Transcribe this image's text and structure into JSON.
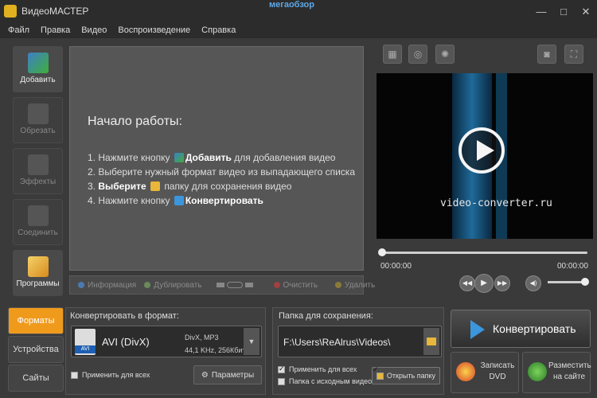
{
  "window": {
    "title": "ВидеоМАСТЕР",
    "watermark": "мегаобзор",
    "controls": [
      "—",
      "□",
      "✕"
    ]
  },
  "menu": [
    "Файл",
    "Правка",
    "Видео",
    "Воспроизведение",
    "Справка"
  ],
  "tools": [
    {
      "label": "Добавить",
      "icon": "film-add-icon",
      "active": true
    },
    {
      "label": "Обрезать",
      "icon": "scissors-icon",
      "active": false
    },
    {
      "label": "Эффекты",
      "icon": "effects-icon",
      "active": false
    },
    {
      "label": "Соединить",
      "icon": "join-icon",
      "active": false
    },
    {
      "label": "Программы",
      "icon": "programs-icon",
      "active": true
    }
  ],
  "workarea": {
    "title": "Начало работы:",
    "steps": [
      {
        "pre": "1. Нажмите кнопку",
        "bold": "Добавить",
        "post": "для добавления видео"
      },
      {
        "text": "2. Выберите нужный формат видео из выпадающего списка"
      },
      {
        "pre": "3.",
        "bold": "Выберите",
        "post": "папку для сохранения видео"
      },
      {
        "pre": "4. Нажмите кнопку",
        "bold": "Конвертировать",
        "post": ""
      }
    ]
  },
  "listbar": {
    "info": "Информация",
    "duplicate": "Дублировать",
    "clear": "Очистить",
    "delete": "Удалить"
  },
  "preview": {
    "caption": "video-converter.ru",
    "time_current": "00:00:00",
    "time_total": "00:00:00",
    "volume": 1.0,
    "progress": 0.0
  },
  "tabs": [
    "Форматы",
    "Устройства",
    "Сайты"
  ],
  "format": {
    "title": "Конвертировать в формат:",
    "name": "AVI (DivX)",
    "badge": "AVI",
    "codec_line1": "DivX, MP3",
    "codec_line2": "44,1 KHz, 256Кбит",
    "apply_all": "Применить для всех",
    "params": "Параметры"
  },
  "save": {
    "title": "Папка для сохранения:",
    "path": "F:\\Users\\ReAlrus\\Videos\\",
    "apply_all": "Применить для всех",
    "source_folder": "Папка с исходным видео",
    "open_folder": "Открыть папку"
  },
  "actions": {
    "convert": "Конвертировать",
    "burn_l1": "Записать",
    "burn_l2": "DVD",
    "publish_l1": "Разместить",
    "publish_l2": "на сайте"
  },
  "colors": {
    "accent": "#f09a1c",
    "brand_blue": "#3b96dc",
    "add_green": "#3fae3a"
  }
}
